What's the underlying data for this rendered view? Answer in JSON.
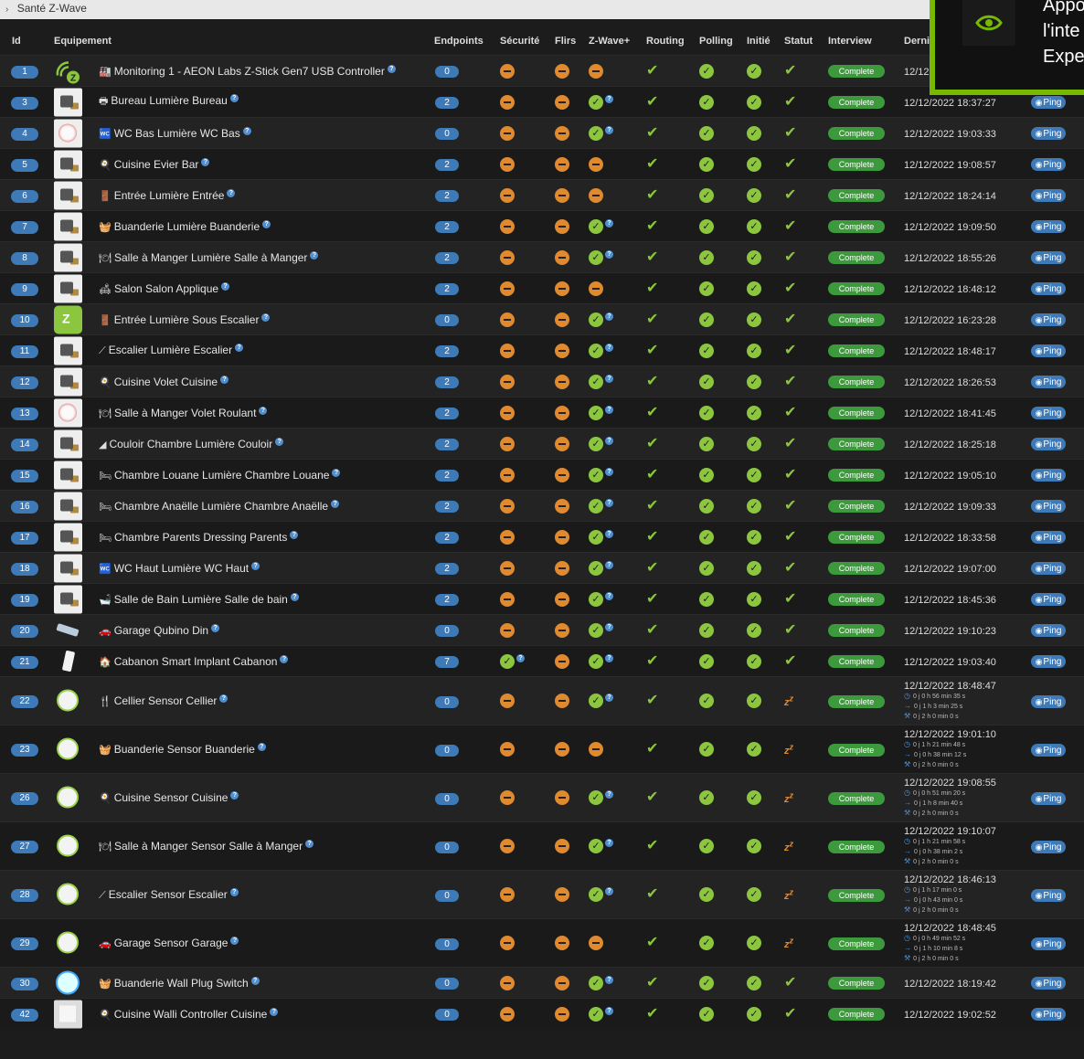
{
  "breadcrumb": "Santé Z-Wave",
  "overlay_text": [
    "Appo",
    "l'inte",
    "Expe"
  ],
  "columns": [
    "Id",
    "Equipement",
    "Endpoints",
    "Sécurité",
    "Flirs",
    "Z-Wave+",
    "Routing",
    "Polling",
    "Initié",
    "Statut",
    "Interview",
    "Derni"
  ],
  "ping_label": "Ping",
  "interview_label": "Complete",
  "rows": [
    {
      "id": "1",
      "thumb": "aeon",
      "icon": "🏭",
      "name": "Monitoring 1 - AEON Labs Z-Stick Gen7 USB Controller",
      "ep": "0",
      "sec": "minus",
      "flirs": "minus",
      "zwp": "minus",
      "status": "check",
      "date": "12/12",
      "ping": false,
      "h": 34
    },
    {
      "id": "3",
      "thumb": "switch",
      "icon": "🖶",
      "name": "Bureau Lumière Bureau",
      "ep": "2",
      "sec": "minus",
      "flirs": "minus",
      "zwp": "okq",
      "status": "check",
      "date": "12/12/2022 18:37:27",
      "ping": true,
      "h": 34
    },
    {
      "id": "4",
      "thumb": "round",
      "icon": "🚾",
      "name": "WC Bas Lumière WC Bas",
      "ep": "0",
      "sec": "minus",
      "flirs": "minus",
      "zwp": "okq",
      "status": "check",
      "date": "12/12/2022 19:03:33",
      "ping": true,
      "h": 34
    },
    {
      "id": "5",
      "thumb": "switch",
      "icon": "🍳",
      "name": "Cuisine Evier Bar",
      "ep": "2",
      "sec": "minus",
      "flirs": "minus",
      "zwp": "minus",
      "status": "check",
      "date": "12/12/2022 19:08:57",
      "ping": true,
      "h": 34
    },
    {
      "id": "6",
      "thumb": "switch",
      "icon": "🚪",
      "name": "Entrée Lumière Entrée",
      "ep": "2",
      "sec": "minus",
      "flirs": "minus",
      "zwp": "minus",
      "status": "check",
      "date": "12/12/2022 18:24:14",
      "ping": true,
      "h": 34
    },
    {
      "id": "7",
      "thumb": "switch",
      "icon": "🧺",
      "name": "Buanderie Lumière Buanderie",
      "ep": "2",
      "sec": "minus",
      "flirs": "minus",
      "zwp": "okq",
      "status": "check",
      "date": "12/12/2022 19:09:50",
      "ping": true,
      "h": 34
    },
    {
      "id": "8",
      "thumb": "switch",
      "icon": "🍽",
      "name": "Salle à Manger Lumière Salle à Manger",
      "ep": "2",
      "sec": "minus",
      "flirs": "minus",
      "zwp": "okq",
      "status": "check",
      "date": "12/12/2022 18:55:26",
      "ping": true,
      "h": 34
    },
    {
      "id": "9",
      "thumb": "switch",
      "icon": "🛋",
      "name": "Salon Salon Applique",
      "ep": "2",
      "sec": "minus",
      "flirs": "minus",
      "zwp": "minus",
      "status": "check",
      "date": "12/12/2022 18:48:12",
      "ping": true,
      "h": 34
    },
    {
      "id": "10",
      "thumb": "green",
      "icon": "🚪",
      "name": "Entrée Lumière Sous Escalier",
      "ep": "0",
      "sec": "minus",
      "flirs": "minus",
      "zwp": "okq",
      "status": "check",
      "date": "12/12/2022 16:23:28",
      "ping": true,
      "h": 34
    },
    {
      "id": "11",
      "thumb": "switch",
      "icon": "⟋",
      "name": "Escalier Lumière Escalier",
      "ep": "2",
      "sec": "minus",
      "flirs": "minus",
      "zwp": "okq",
      "status": "check",
      "date": "12/12/2022 18:48:17",
      "ping": true,
      "h": 34
    },
    {
      "id": "12",
      "thumb": "switch",
      "icon": "🍳",
      "name": "Cuisine Volet Cuisine",
      "ep": "2",
      "sec": "minus",
      "flirs": "minus",
      "zwp": "okq",
      "status": "check",
      "date": "12/12/2022 18:26:53",
      "ping": true,
      "h": 34
    },
    {
      "id": "13",
      "thumb": "round",
      "icon": "🍽",
      "name": "Salle à Manger Volet Roulant",
      "ep": "2",
      "sec": "minus",
      "flirs": "minus",
      "zwp": "okq",
      "status": "check",
      "date": "12/12/2022 18:41:45",
      "ping": true,
      "h": 34
    },
    {
      "id": "14",
      "thumb": "switch",
      "icon": "◢",
      "name": "Couloir Chambre Lumière Couloir",
      "ep": "2",
      "sec": "minus",
      "flirs": "minus",
      "zwp": "okq",
      "status": "check",
      "date": "12/12/2022 18:25:18",
      "ping": true,
      "h": 34
    },
    {
      "id": "15",
      "thumb": "switch",
      "icon": "🛏",
      "name": "Chambre Louane Lumière Chambre Louane",
      "ep": "2",
      "sec": "minus",
      "flirs": "minus",
      "zwp": "okq",
      "status": "check",
      "date": "12/12/2022 19:05:10",
      "ping": true,
      "h": 34
    },
    {
      "id": "16",
      "thumb": "switch",
      "icon": "🛏",
      "name": "Chambre Anaëlle Lumière Chambre Anaëlle",
      "ep": "2",
      "sec": "minus",
      "flirs": "minus",
      "zwp": "okq",
      "status": "check",
      "date": "12/12/2022 19:09:33",
      "ping": true,
      "h": 34
    },
    {
      "id": "17",
      "thumb": "switch",
      "icon": "🛏",
      "name": "Chambre Parents Dressing Parents",
      "ep": "2",
      "sec": "minus",
      "flirs": "minus",
      "zwp": "okq",
      "status": "check",
      "date": "12/12/2022 18:33:58",
      "ping": true,
      "h": 34
    },
    {
      "id": "18",
      "thumb": "switch",
      "icon": "🚾",
      "name": "WC Haut Lumière WC Haut",
      "ep": "2",
      "sec": "minus",
      "flirs": "minus",
      "zwp": "okq",
      "status": "check",
      "date": "12/12/2022 19:07:00",
      "ping": true,
      "h": 34
    },
    {
      "id": "19",
      "thumb": "switch",
      "icon": "🛁",
      "name": "Salle de Bain Lumière Salle de bain",
      "ep": "2",
      "sec": "minus",
      "flirs": "minus",
      "zwp": "okq",
      "status": "check",
      "date": "12/12/2022 18:45:36",
      "ping": true,
      "h": 34
    },
    {
      "id": "20",
      "thumb": "din",
      "icon": "🚗",
      "name": "Garage Qubino Din",
      "ep": "0",
      "sec": "minus",
      "flirs": "minus",
      "zwp": "okq",
      "status": "check",
      "date": "12/12/2022 19:10:23",
      "ping": true,
      "h": 34
    },
    {
      "id": "21",
      "thumb": "implant",
      "icon": "🏠",
      "name": "Cabanon Smart Implant Cabanon",
      "ep": "7",
      "sec": "okq",
      "flirs": "minus",
      "zwp": "okq",
      "status": "check",
      "date": "12/12/2022 19:03:40",
      "ping": true,
      "h": 34
    },
    {
      "id": "22",
      "thumb": "sensor",
      "icon": "🍴",
      "name": "Cellier Sensor Cellier",
      "ep": "0",
      "sec": "minus",
      "flirs": "minus",
      "zwp": "okq",
      "status": "sleep",
      "date": "12/12/2022 18:48:47",
      "subs": [
        "0 j 0 h 56 min 35 s",
        "0 j 1 h 3 min 25 s",
        "0 j 2 h 0 min 0 s"
      ],
      "ping": true,
      "h": 53
    },
    {
      "id": "23",
      "thumb": "sensor",
      "icon": "🧺",
      "name": "Buanderie Sensor Buanderie",
      "ep": "0",
      "sec": "minus",
      "flirs": "minus",
      "zwp": "minus",
      "status": "sleep",
      "date": "12/12/2022 19:01:10",
      "subs": [
        "0 j 1 h 21 min 48 s",
        "0 j 0 h 38 min 12 s",
        "0 j 2 h 0 min 0 s"
      ],
      "ping": true,
      "h": 53
    },
    {
      "id": "26",
      "thumb": "sensor",
      "icon": "🍳",
      "name": "Cuisine Sensor Cuisine",
      "ep": "0",
      "sec": "minus",
      "flirs": "minus",
      "zwp": "okq",
      "status": "sleep",
      "date": "12/12/2022 19:08:55",
      "subs": [
        "0 j 0 h 51 min 20 s",
        "0 j 1 h 8 min 40 s",
        "0 j 2 h 0 min 0 s"
      ],
      "ping": true,
      "h": 53
    },
    {
      "id": "27",
      "thumb": "sensor",
      "icon": "🍽",
      "name": "Salle à Manger Sensor Salle à Manger",
      "ep": "0",
      "sec": "minus",
      "flirs": "minus",
      "zwp": "okq",
      "status": "sleep",
      "date": "12/12/2022 19:10:07",
      "subs": [
        "0 j 1 h 21 min 58 s",
        "0 j 0 h 38 min 2 s",
        "0 j 2 h 0 min 0 s"
      ],
      "ping": true,
      "h": 53
    },
    {
      "id": "28",
      "thumb": "sensor",
      "icon": "⟋",
      "name": "Escalier Sensor Escalier",
      "ep": "0",
      "sec": "minus",
      "flirs": "minus",
      "zwp": "okq",
      "status": "sleep",
      "date": "12/12/2022 18:46:13",
      "subs": [
        "0 j 1 h 17 min 0 s",
        "0 j 0 h 43 min 0 s",
        "0 j 2 h 0 min 0 s"
      ],
      "ping": true,
      "h": 53
    },
    {
      "id": "29",
      "thumb": "sensor",
      "icon": "🚗",
      "name": "Garage Sensor Garage",
      "ep": "0",
      "sec": "minus",
      "flirs": "minus",
      "zwp": "minus",
      "status": "sleep",
      "date": "12/12/2022 18:48:45",
      "subs": [
        "0 j 0 h 49 min 52 s",
        "0 j 1 h 10 min 8 s",
        "0 j 2 h 0 min 0 s"
      ],
      "ping": true,
      "h": 53
    },
    {
      "id": "30",
      "thumb": "plug",
      "icon": "🧺",
      "name": "Buanderie Wall Plug Switch",
      "ep": "0",
      "sec": "minus",
      "flirs": "minus",
      "zwp": "okq",
      "status": "check",
      "date": "12/12/2022 18:19:42",
      "ping": true,
      "h": 34
    },
    {
      "id": "42",
      "thumb": "walli",
      "icon": "🍳",
      "name": "Cuisine Walli Controller Cuisine",
      "ep": "0",
      "sec": "minus",
      "flirs": "minus",
      "zwp": "okq",
      "status": "check",
      "date": "12/12/2022 19:02:52",
      "ping": true,
      "h": 34
    }
  ]
}
